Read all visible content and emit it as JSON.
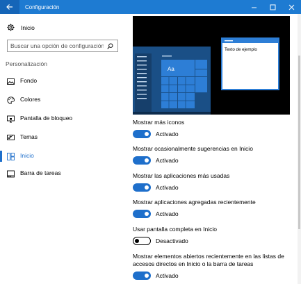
{
  "window": {
    "title": "Configuración",
    "accent": "#1e7bd2"
  },
  "sidebar": {
    "home_label": "Inicio",
    "search_placeholder": "Buscar una opción de configuración",
    "section_title": "Personalización",
    "items": [
      {
        "label": "Fondo",
        "icon": "picture-icon"
      },
      {
        "label": "Colores",
        "icon": "palette-icon"
      },
      {
        "label": "Pantalla de bloqueo",
        "icon": "monitor-lock-icon"
      },
      {
        "label": "Temas",
        "icon": "brush-icon"
      },
      {
        "label": "Inicio",
        "icon": "start-icon",
        "selected": true
      },
      {
        "label": "Barra de tareas",
        "icon": "taskbar-icon"
      }
    ]
  },
  "preview": {
    "sample_text": "Texto de ejemplo",
    "tile_text": "Aa"
  },
  "settings": [
    {
      "label": "Mostrar más iconos",
      "state": "on",
      "state_label": "Activado"
    },
    {
      "label": "Mostrar ocasionalmente sugerencias en Inicio",
      "state": "on",
      "state_label": "Activado"
    },
    {
      "label": "Mostrar las aplicaciones más usadas",
      "state": "on",
      "state_label": "Activado"
    },
    {
      "label": "Mostrar aplicaciones agregadas recientemente",
      "state": "on",
      "state_label": "Activado"
    },
    {
      "label": "Usar pantalla completa en Inicio",
      "state": "off",
      "state_label": "Desactivado"
    },
    {
      "label": "Mostrar elementos abiertos recientemente en las listas de accesos directos en Inicio o la barra de tareas",
      "state": "on",
      "state_label": "Activado"
    }
  ]
}
